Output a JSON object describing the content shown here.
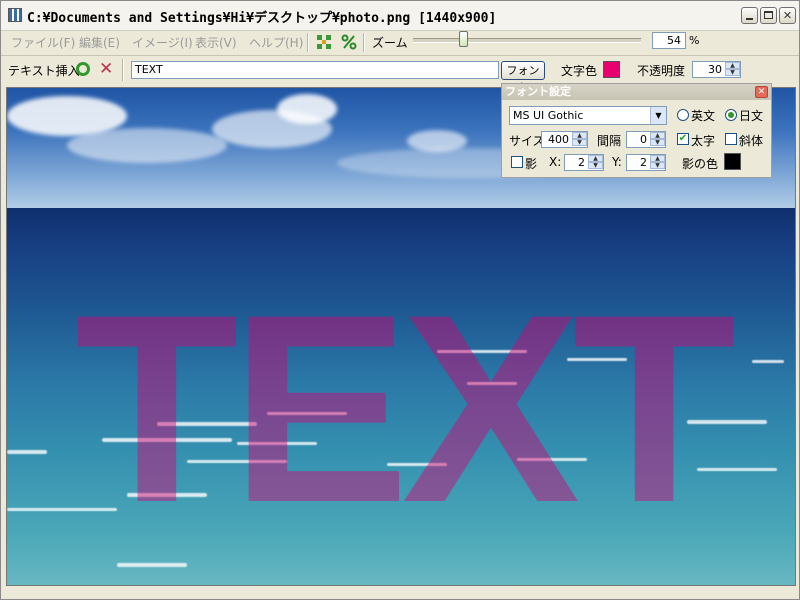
{
  "window": {
    "title": "C:¥Documents and Settings¥Hi¥デスクトップ¥photo.png  [1440x900]"
  },
  "menu": [
    {
      "label": "ファイル(F)"
    },
    {
      "label": "編集(E)"
    },
    {
      "label": "イメージ(I)"
    },
    {
      "label": "表示(V)"
    },
    {
      "label": "ヘルプ(H)"
    }
  ],
  "toolbar": {
    "zoom_label": "ズーム",
    "zoom_value": "54",
    "zoom_unit": "%",
    "icons": [
      "fit-to-window-icon",
      "actual-size-icon"
    ]
  },
  "text_insert": {
    "label": "テキスト挿入",
    "text_value": "TEXT",
    "font_button": "フォント",
    "color_label": "文字色",
    "color": "#E8006F",
    "opacity_label": "不透明度",
    "opacity_value": "30"
  },
  "font_panel": {
    "title": "フォント設定",
    "font_name": "MS UI Gothic",
    "lang_en": "英文",
    "lang_ja": "日文",
    "size_label": "サイズ",
    "size_value": "400",
    "spacing_label": "間隔",
    "spacing_value": "0",
    "bold_label": "太字",
    "italic_label": "斜体",
    "shadow_label": "影",
    "x_label": "X:",
    "x_value": "2",
    "y_label": "Y:",
    "y_value": "2",
    "shadow_color_label": "影の色",
    "shadow_color": "#000000",
    "bold_checked": true,
    "italic_checked": false,
    "shadow_checked": false,
    "selected_lang": "日文"
  },
  "canvas": {
    "overlay_text": "TEXT"
  }
}
